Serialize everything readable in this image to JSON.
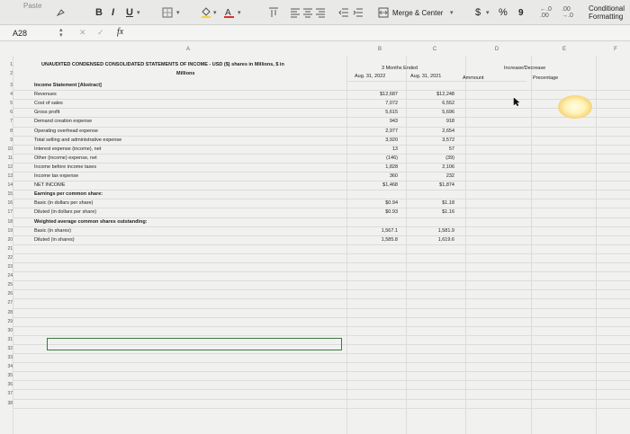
{
  "ribbon": {
    "paste": "Paste",
    "bold": "B",
    "italic": "I",
    "underline": "U",
    "merge_center": "Merge & Center",
    "currency": "$",
    "percent": "%",
    "comma": "9",
    "conditional_formatting_line1": "Conditional",
    "conditional_formatting_line2": "Formatting"
  },
  "formula_bar": {
    "name_box": "A28",
    "fx": "fx",
    "content": ""
  },
  "columns": [
    "A",
    "B",
    "C",
    "D",
    "E",
    "F"
  ],
  "sheet": {
    "title_line1": "UNAUDITED CONDENSED CONSOLIDATED STATEMENTS OF INCOME - USD ($) shares in Millions, $ in",
    "title_line2": "Millions",
    "header_period": "3 Months Ended",
    "header_col_b": "Aug. 31, 2022",
    "header_col_c": "Aug. 31, 2021",
    "header_col_d": "Ammount",
    "header_col_e_line1": "Increase/Decrease",
    "header_col_e_line2": "Precentage",
    "rows": [
      {
        "n": "3",
        "label": "Income Statement [Abstract]",
        "b": "",
        "c": "",
        "bold": true
      },
      {
        "n": "4",
        "label": "Revenues",
        "b": "$12,687",
        "c": "$12,248"
      },
      {
        "n": "5",
        "label": "Cost of sales",
        "b": "7,072",
        "c": "6,552"
      },
      {
        "n": "6",
        "label": "Gross profit",
        "b": "5,615",
        "c": "5,696"
      },
      {
        "n": "7",
        "label": "Demand creation expense",
        "b": "943",
        "c": "918"
      },
      {
        "n": "8",
        "label": "Operating overhead expense",
        "b": "2,977",
        "c": "2,654"
      },
      {
        "n": "9",
        "label": "Total selling and administrative expense",
        "b": "3,920",
        "c": "3,572"
      },
      {
        "n": "10",
        "label": "Interest expense (income), net",
        "b": "13",
        "c": "57"
      },
      {
        "n": "11",
        "label": "Other (income) expense, net",
        "b": "(146)",
        "c": "(39)"
      },
      {
        "n": "12",
        "label": "Income before income taxes",
        "b": "1,828",
        "c": "2,106"
      },
      {
        "n": "13",
        "label": "Income tax expense",
        "b": "360",
        "c": "232"
      },
      {
        "n": "14",
        "label": "NET INCOME",
        "b": "$1,468",
        "c": "$1,874"
      },
      {
        "n": "15",
        "label": "Earnings per common share:",
        "b": "",
        "c": "",
        "bold": true
      },
      {
        "n": "16",
        "label": "Basic (in dollars per share)",
        "b": "$0.94",
        "c": "$1.18"
      },
      {
        "n": "17",
        "label": "Diluted (in dollars per share)",
        "b": "$0.93",
        "c": "$1.16"
      },
      {
        "n": "18",
        "label": "Weighted average common shares outstanding:",
        "b": "",
        "c": "",
        "bold": true
      },
      {
        "n": "19",
        "label": "Basic (in shares)",
        "b": "1,567.1",
        "c": "1,581.9"
      },
      {
        "n": "20",
        "label": "Diluted (in shares)",
        "b": "1,585.8",
        "c": "1,619.6"
      }
    ],
    "empty_rows": [
      "21",
      "22",
      "23",
      "24",
      "25",
      "26",
      "27",
      "28",
      "29",
      "30",
      "31",
      "32",
      "33",
      "34",
      "35",
      "36",
      "37",
      "38"
    ]
  }
}
